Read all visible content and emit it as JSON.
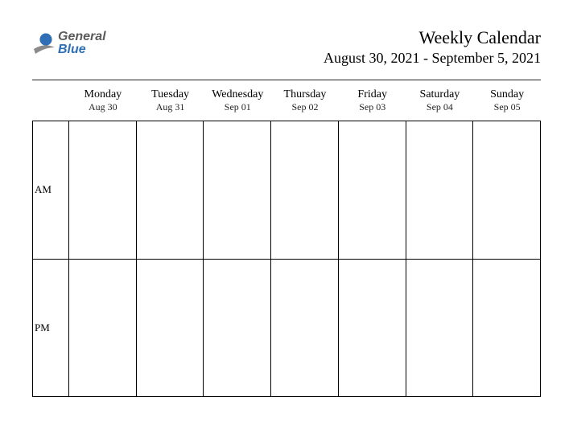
{
  "logo": {
    "word1": "General",
    "word2": "Blue"
  },
  "header": {
    "title": "Weekly Calendar",
    "date_range": "August 30, 2021 - September 5, 2021"
  },
  "days": [
    {
      "name": "Monday",
      "date": "Aug 30"
    },
    {
      "name": "Tuesday",
      "date": "Aug 31"
    },
    {
      "name": "Wednesday",
      "date": "Sep 01"
    },
    {
      "name": "Thursday",
      "date": "Sep 02"
    },
    {
      "name": "Friday",
      "date": "Sep 03"
    },
    {
      "name": "Saturday",
      "date": "Sep 04"
    },
    {
      "name": "Sunday",
      "date": "Sep 05"
    }
  ],
  "rows": [
    {
      "label": "AM"
    },
    {
      "label": "PM"
    }
  ]
}
